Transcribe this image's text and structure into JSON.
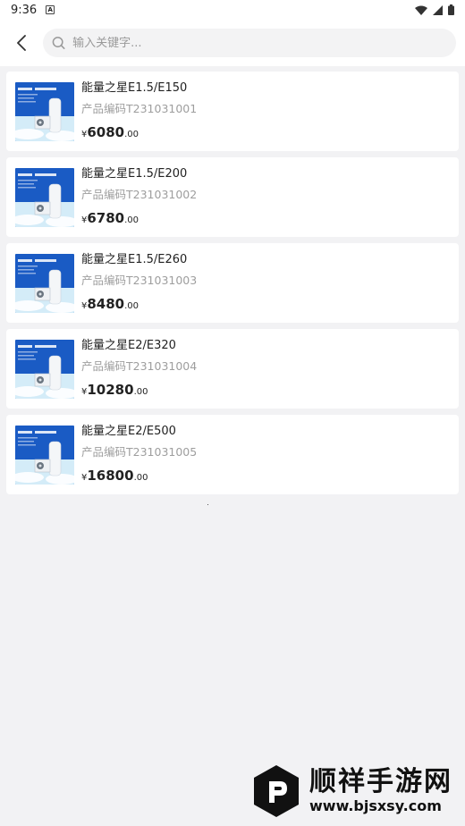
{
  "status_bar": {
    "time": "9:36",
    "notification_badge": "A"
  },
  "search": {
    "placeholder": "输入关键字..."
  },
  "products": [
    {
      "title": "能量之星E1.5/E150",
      "code": "产品编码T231031001",
      "currency": "¥",
      "price_integer": "6080",
      "price_decimal": ".00"
    },
    {
      "title": "能量之星E1.5/E200",
      "code": "产品编码T231031002",
      "currency": "¥",
      "price_integer": "6780",
      "price_decimal": ".00"
    },
    {
      "title": "能量之星E1.5/E260",
      "code": "产品编码T231031003",
      "currency": "¥",
      "price_integer": "8480",
      "price_decimal": ".00"
    },
    {
      "title": "能量之星E2/E320",
      "code": "产品编码T231031004",
      "currency": "¥",
      "price_integer": "10280",
      "price_decimal": ".00"
    },
    {
      "title": "能量之星E2/E500",
      "code": "产品编码T231031005",
      "currency": "¥",
      "price_integer": "16800",
      "price_decimal": ".00"
    }
  ],
  "watermark": {
    "name": "顺祥手游网",
    "url": "www.bjsxsy.com"
  },
  "icons": {
    "back": "chevron-left-icon",
    "search": "search-icon",
    "wifi": "wifi-icon",
    "signal": "signal-icon",
    "battery": "battery-icon",
    "product_image": "heat-pump-image"
  },
  "colors": {
    "price": "#222222",
    "code": "#9e9e9e",
    "thumb_blue": "#1a5bc4"
  }
}
